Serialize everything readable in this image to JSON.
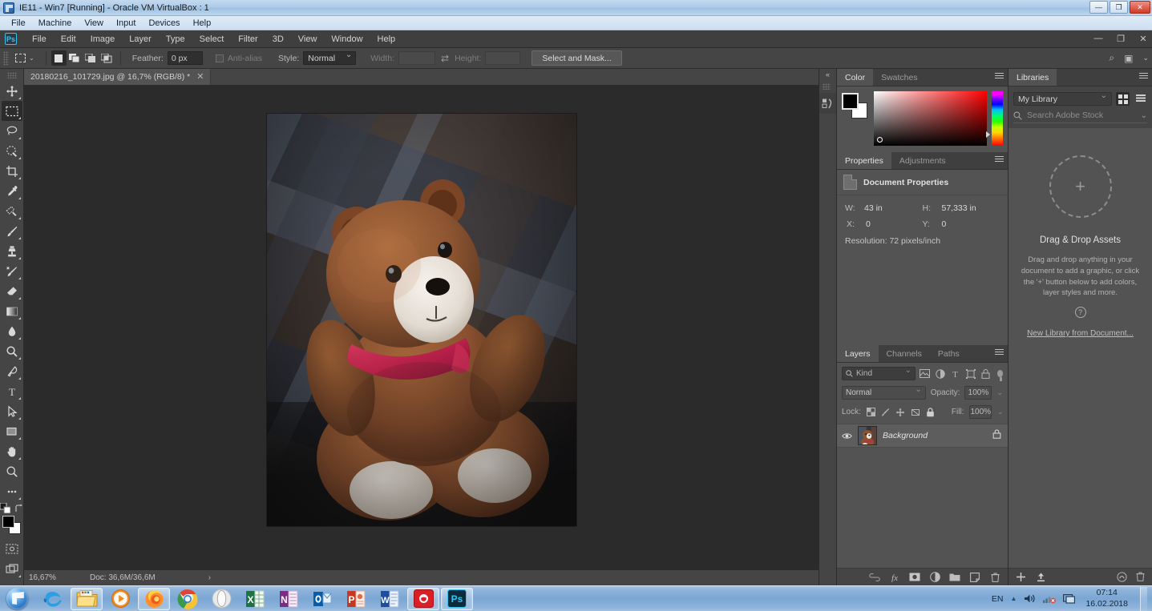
{
  "vbox": {
    "title": "IE11 - Win7 [Running] - Oracle VM VirtualBox : 1",
    "menu": [
      "File",
      "Machine",
      "View",
      "Input",
      "Devices",
      "Help"
    ],
    "buttons": {
      "minimize": "—",
      "restore": "❐",
      "close": "✕"
    }
  },
  "photoshop": {
    "logo": "Ps",
    "menu": [
      "File",
      "Edit",
      "Image",
      "Layer",
      "Type",
      "Select",
      "Filter",
      "3D",
      "View",
      "Window",
      "Help"
    ],
    "window_buttons": {
      "minimize": "—",
      "restore": "❐",
      "close": "✕"
    },
    "options_bar": {
      "tool": "rectangular-marquee",
      "feather_label": "Feather:",
      "feather_value": "0 px",
      "antialias_label": "Anti-alias",
      "style_label": "Style:",
      "style_value": "Normal",
      "width_label": "Width:",
      "width_value": "",
      "height_label": "Height:",
      "height_value": "",
      "select_and_mask": "Select and Mask...",
      "swap_icon": "⇄"
    },
    "document_tab": {
      "label": "20180216_101729.jpg @ 16,7% (RGB/8) *",
      "close": "✕"
    },
    "status_bar": {
      "zoom": "16,67%",
      "doc": "Doc: 36,6M/36,6M",
      "arrow": "›"
    },
    "toolbox": [
      {
        "name": "move-tool",
        "label": "Move"
      },
      {
        "name": "rectangular-marquee-tool",
        "label": "Rectangular Marquee",
        "selected": true
      },
      {
        "name": "lasso-tool",
        "label": "Lasso"
      },
      {
        "name": "quick-selection-tool",
        "label": "Quick Selection"
      },
      {
        "name": "crop-tool",
        "label": "Crop"
      },
      {
        "name": "eyedropper-tool",
        "label": "Eyedropper"
      },
      {
        "name": "spot-healing-brush-tool",
        "label": "Spot Healing Brush"
      },
      {
        "name": "brush-tool",
        "label": "Brush"
      },
      {
        "name": "clone-stamp-tool",
        "label": "Clone Stamp"
      },
      {
        "name": "history-brush-tool",
        "label": "History Brush"
      },
      {
        "name": "eraser-tool",
        "label": "Eraser"
      },
      {
        "name": "gradient-tool",
        "label": "Gradient"
      },
      {
        "name": "blur-tool",
        "label": "Blur"
      },
      {
        "name": "dodge-tool",
        "label": "Dodge"
      },
      {
        "name": "pen-tool",
        "label": "Pen"
      },
      {
        "name": "type-tool",
        "label": "Horizontal Type"
      },
      {
        "name": "path-selection-tool",
        "label": "Path Selection"
      },
      {
        "name": "rectangle-tool",
        "label": "Rectangle"
      },
      {
        "name": "hand-tool",
        "label": "Hand"
      },
      {
        "name": "zoom-tool",
        "label": "Zoom"
      },
      {
        "name": "edit-toolbar-tool",
        "label": "Edit Toolbar"
      }
    ],
    "color_panel": {
      "tabs": [
        "Color",
        "Swatches"
      ],
      "active_tab": "Color",
      "foreground": "#000000",
      "background": "#ffffff"
    },
    "properties_panel": {
      "tabs": [
        "Properties",
        "Adjustments"
      ],
      "active_tab": "Properties",
      "header": "Document Properties",
      "w_label": "W:",
      "w_value": "43 in",
      "h_label": "H:",
      "h_value": "57,333 in",
      "x_label": "X:",
      "x_value": "0",
      "y_label": "Y:",
      "y_value": "0",
      "resolution": "Resolution: 72 pixels/inch"
    },
    "layers_panel": {
      "tabs": [
        "Layers",
        "Channels",
        "Paths"
      ],
      "active_tab": "Layers",
      "filter_label": "Kind",
      "blend_mode": "Normal",
      "opacity_label": "Opacity:",
      "opacity_value": "100%",
      "lock_label": "Lock:",
      "fill_label": "Fill:",
      "fill_value": "100%",
      "layers": [
        {
          "name": "Background",
          "visible": true,
          "locked": true
        }
      ],
      "footer_icons": [
        "link-icon",
        "fx-icon",
        "add-mask-icon",
        "adjustment-layer-icon",
        "new-group-icon",
        "new-layer-icon",
        "delete-layer-icon"
      ]
    },
    "libraries_panel": {
      "tab": "Libraries",
      "library_select": "My Library",
      "view_grid_icon": "grid-view-icon",
      "view_list_icon": "list-view-icon",
      "search_placeholder": "Search Adobe Stock",
      "empty_title": "Drag & Drop Assets",
      "empty_desc": "Drag and drop anything in your document to add a graphic, or click the '+' button below to add colors, layer styles and more.",
      "help_glyph": "?",
      "link": "New Library from Document...",
      "plus_icon": "add-icon",
      "upload_icon": "upload-icon",
      "cc-icon": "creative-cloud-icon",
      "delete_icon": "delete-icon"
    }
  },
  "taskbar": {
    "start": "start-orb",
    "apps": [
      {
        "name": "internet-explorer",
        "label": "Internet Explorer",
        "open": false
      },
      {
        "name": "windows-explorer",
        "label": "Windows Explorer",
        "open": true
      },
      {
        "name": "windows-media-player",
        "label": "Windows Media Player",
        "open": false
      },
      {
        "name": "firefox",
        "label": "Mozilla Firefox",
        "open": true
      },
      {
        "name": "chrome",
        "label": "Google Chrome",
        "open": false
      },
      {
        "name": "opera",
        "label": "Opera",
        "open": false
      },
      {
        "name": "excel",
        "label": "Microsoft Excel",
        "open": false
      },
      {
        "name": "onenote",
        "label": "Microsoft OneNote",
        "open": false
      },
      {
        "name": "outlook",
        "label": "Microsoft Outlook",
        "open": false
      },
      {
        "name": "powerpoint",
        "label": "Microsoft PowerPoint",
        "open": false
      },
      {
        "name": "word",
        "label": "Microsoft Word",
        "open": false
      },
      {
        "name": "creative-cloud",
        "label": "Adobe Creative Cloud",
        "open": true
      },
      {
        "name": "photoshop",
        "label": "Adobe Photoshop",
        "open": true
      }
    ],
    "tray": {
      "language": "EN",
      "show_hidden": "▲",
      "volume": "volume-icon",
      "network": "network-icon",
      "action-center": "action-center-icon",
      "time": "07:14",
      "date": "16.02.2018"
    }
  }
}
